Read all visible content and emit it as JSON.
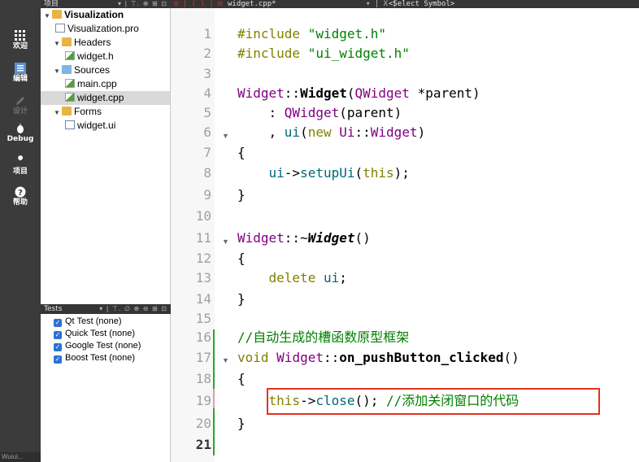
{
  "modebar": {
    "items": [
      {
        "label": "欢迎",
        "icon": "grid-icon"
      },
      {
        "label": "编辑",
        "icon": "edit-icon"
      },
      {
        "label": "设计",
        "icon": "pencil-icon"
      },
      {
        "label": "Debug",
        "icon": "bug-icon"
      },
      {
        "label": "项目",
        "icon": "wrench-icon"
      },
      {
        "label": "帮助",
        "icon": "help-icon"
      }
    ],
    "footer": "Wuiui..."
  },
  "project_pane": {
    "title": "项目",
    "toolbar": "▾ | ⊤. ⊕ ⊞ ⊡",
    "tree": {
      "root": "Visualization",
      "project_file": "Visualization.pro",
      "headers_label": "Headers",
      "header_file": "widget.h",
      "sources_label": "Sources",
      "source_main": "main.cpp",
      "source_widget": "widget.cpp",
      "forms_label": "Forms",
      "form_file": "widget.ui"
    }
  },
  "tests_pane": {
    "title": "Tests",
    "toolbar": "▾ | ⊤. ∅ ⊕ ⊖ ⊞ ⊡",
    "items": [
      "Qt Test (none)",
      "Quick Test (none)",
      "Google Test (none)",
      "Boost Test (none)"
    ]
  },
  "editor_bar": {
    "nav": "⊡ | ⟨ ⟩ | ⊡",
    "filename": "widget.cpp*",
    "symbol": "<Select Symbol>",
    "close": "▾ | X |"
  },
  "editor": {
    "line_numbers": [
      "1",
      "2",
      "3",
      "4",
      "5",
      "6",
      "7",
      "8",
      "9",
      "10",
      "11",
      "12",
      "13",
      "14",
      "15",
      "16",
      "17",
      "18",
      "19",
      "20",
      "21"
    ],
    "current_line": "21",
    "lines": {
      "l1": {
        "kw": "#include",
        "str": " \"widget.h\""
      },
      "l2": {
        "kw": "#include",
        "str": " \"ui_widget.h\""
      },
      "l4": {
        "cls": "Widget",
        "sep": "::",
        "fn": "Widget",
        "open": "(",
        "type": "QWidget",
        "rest": " *parent)"
      },
      "l5": {
        "lead": "    : ",
        "cls": "QWidget",
        "rest": "(parent)"
      },
      "l6": {
        "lead": "    , ",
        "m": "ui",
        "open": "(",
        "kw": "new",
        "sp": " ",
        "ns": "Ui",
        "sep": "::",
        "cls": "Widget",
        "close": ")"
      },
      "l7": "{",
      "l8": {
        "lead": "    ",
        "m": "ui",
        "arrow": "->",
        "fn": "setupUi",
        "open": "(",
        "kw": "this",
        "close": ");"
      },
      "l9": "}",
      "l11": {
        "cls": "Widget",
        "sep": "::~",
        "fn": "Widget",
        "rest": "()"
      },
      "l12": "{",
      "l13": {
        "lead": "    ",
        "kw": "delete",
        "sp": " ",
        "m": "ui",
        "end": ";"
      },
      "l14": "}",
      "l16": "//自动生成的槽函数原型框架",
      "l17": {
        "kw": "void",
        "sp": " ",
        "cls": "Widget",
        "sep": "::",
        "fn": "on_pushButton_clicked",
        "rest": "()"
      },
      "l18": "{",
      "l19": {
        "lead": "    ",
        "kw": "this",
        "arrow": "->",
        "fn": "close",
        "mid": "(); ",
        "cm": "//添加关闭窗口的代码"
      },
      "l20": "}"
    }
  }
}
